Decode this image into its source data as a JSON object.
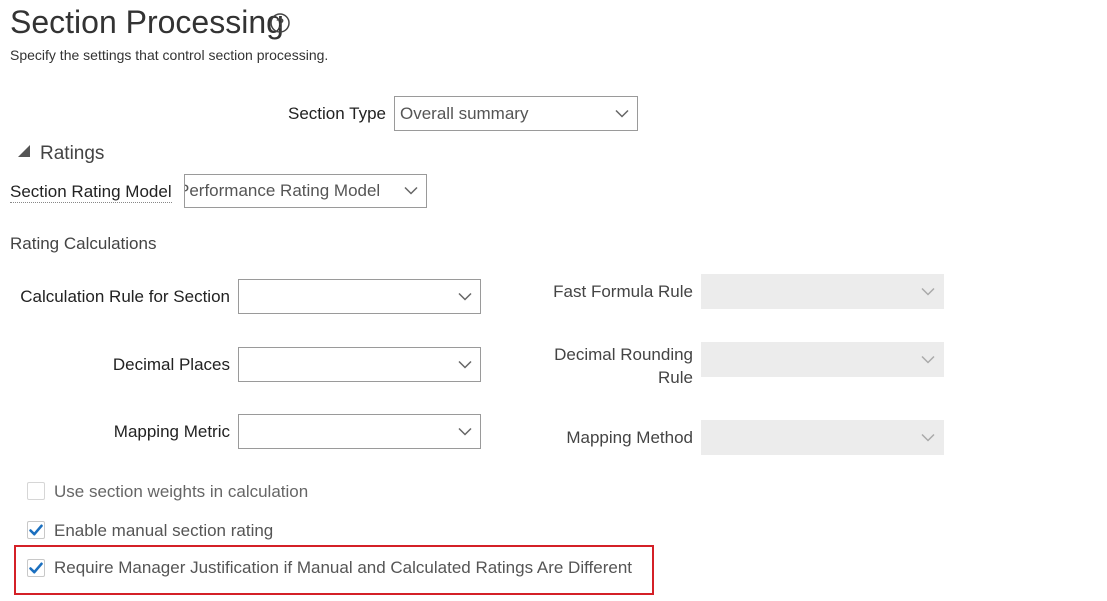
{
  "header": {
    "title": "Section Processing",
    "subtitle": "Specify the settings that control section processing."
  },
  "section_type": {
    "label": "Section Type",
    "value": "Overall summary"
  },
  "ratings": {
    "heading": "Ratings",
    "section_rating_model": {
      "label": "Section Rating Model",
      "value": "Performance Rating Model"
    },
    "rating_calculations": {
      "heading": "Rating Calculations",
      "calculation_rule_for_section": {
        "label": "Calculation Rule for Section",
        "value": ""
      },
      "decimal_places": {
        "label": "Decimal Places",
        "value": ""
      },
      "mapping_metric": {
        "label": "Mapping Metric",
        "value": ""
      },
      "fast_formula_rule": {
        "label": "Fast Formula Rule",
        "value": ""
      },
      "decimal_rounding_rule": {
        "label_line1": "Decimal Rounding",
        "label_line2": "Rule",
        "value": ""
      },
      "mapping_method": {
        "label": "Mapping Method",
        "value": ""
      }
    },
    "checkboxes": [
      {
        "label": "Use section weights in calculation",
        "checked": false
      },
      {
        "label": "Enable manual section rating",
        "checked": true
      },
      {
        "label": "Require Manager Justification if Manual and Calculated Ratings Are Different",
        "checked": true
      }
    ]
  },
  "colors": {
    "accent_check": "#1b6fbf",
    "highlight_border": "#d42027",
    "disabled_field": "#ececec"
  },
  "icons": {
    "help": "help-icon",
    "collapse": "collapse-triangle-icon",
    "dropdown": "chevron-down-icon",
    "check": "checkmark-icon"
  }
}
